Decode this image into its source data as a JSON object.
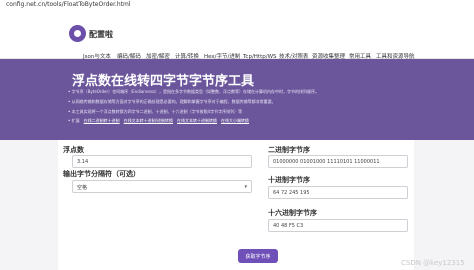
{
  "browser": {
    "url": "config.net.cn/tools/FloatToByteOrder.html"
  },
  "site": {
    "name": "配置啦"
  },
  "nav": [
    "Json与文本",
    "编码/解码",
    "加密/解密",
    "计算/转换",
    "Hex/字节/进制",
    "Tcp/Http/WS",
    "技术/对照表",
    "资源收集整理",
    "常用工具",
    "工具和资源导航"
  ],
  "banner": {
    "title": "浮点数在线转四字节字节序工具",
    "lines": [
      "字节序（ByteOrder）也叫端序（Endianness），是指在多字节数据类型（如整数、浮点数等）存储在计算机内存中时，字节的排列顺序。",
      "从网络传输和数据存储等方面对字节序的正确处理是必要的。理解和掌握字节序对于编程、数据传输等都非常重要。",
      "本工具实现将一个浮点数转换为四字节二进制、十进制、十六进制（字节按照4字节字序排列）等",
      "扩展"
    ],
    "links": [
      "在线二进制转十进制",
      "在线文本转十进制/进制转换",
      "在线文本转十进制转换",
      "在线大小端转换"
    ]
  },
  "form": {
    "float_label": "浮点数",
    "float_value": "3.14",
    "order_label": "输出字节分隔符（可选）",
    "order_value": "空格",
    "binary_label": "二进制字节序",
    "binary_value": "01000000 01001000 11110101 11000011",
    "decimal_label": "十进制字节序",
    "decimal_value": "64 72 245 195",
    "hex_label": "十六进制字节序",
    "hex_value": "40 48 F5 C3",
    "convert_label": "获取字节序"
  },
  "watermark": "CSDN @key12315"
}
